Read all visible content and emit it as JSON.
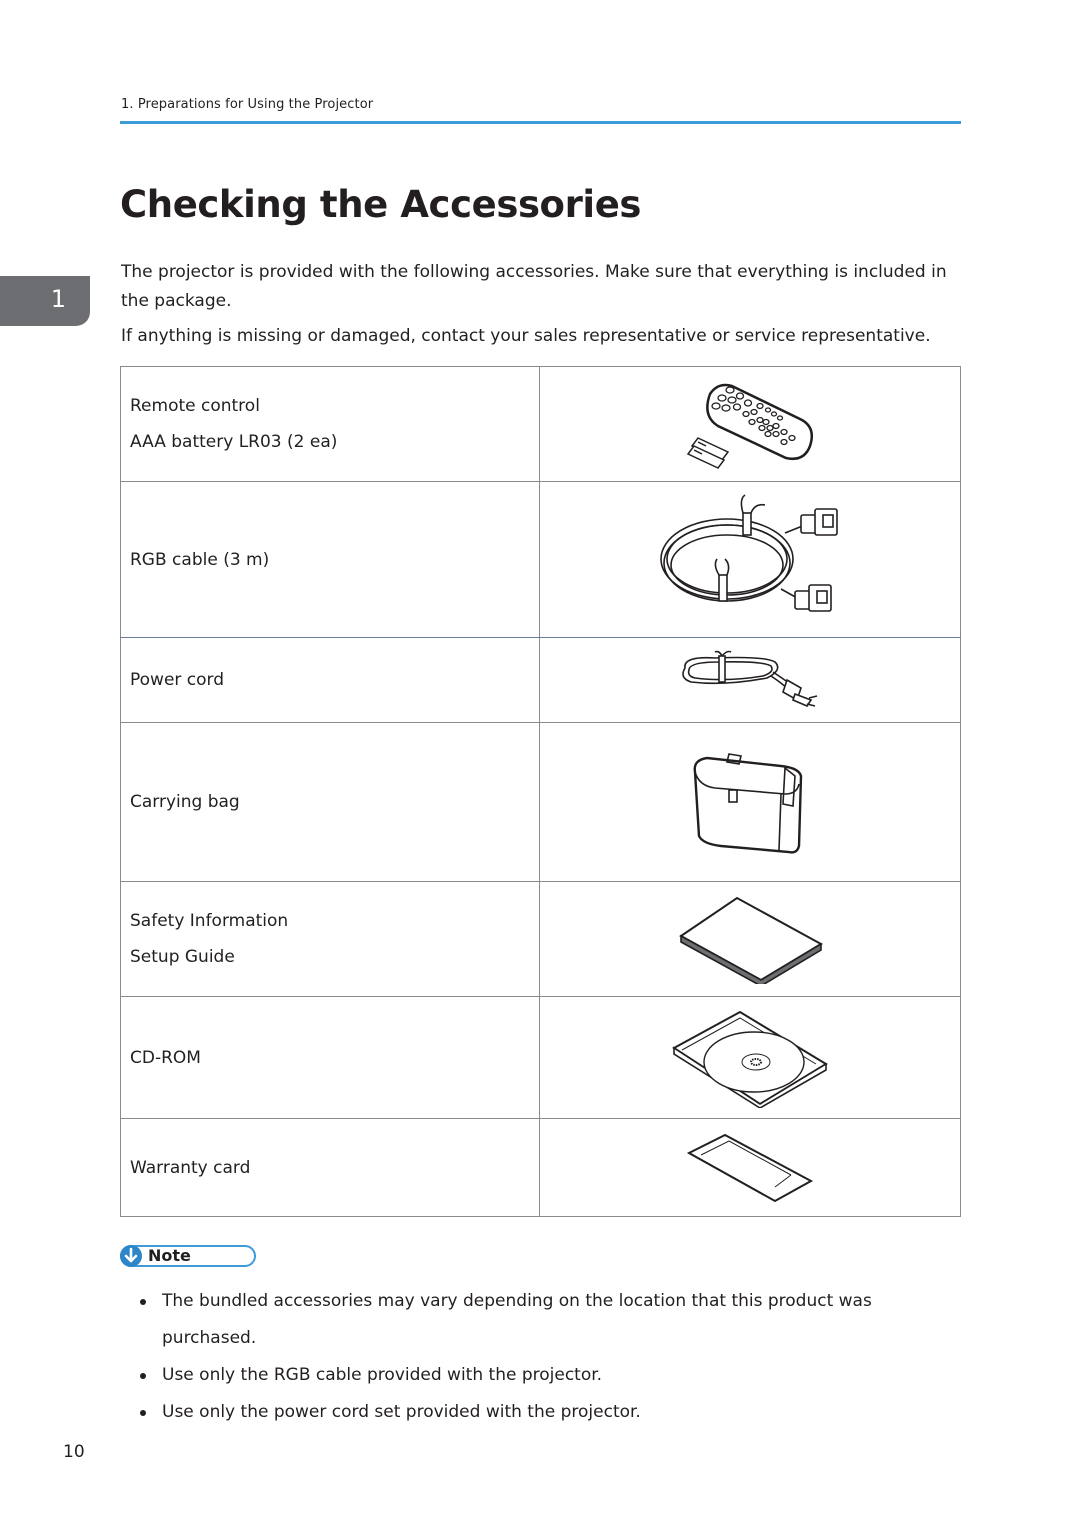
{
  "header": {
    "running_head": "1. Preparations for Using the Projector",
    "accent_color": "#3d9bd9"
  },
  "chapter_tab": {
    "number": "1"
  },
  "title": "Checking the Accessories",
  "intro": {
    "paragraph1": "The projector is provided with the following accessories. Make sure that everything is included in the package.",
    "paragraph2": "If anything is missing or damaged, contact your sales representative or service representative."
  },
  "accessories": [
    {
      "lines": [
        "Remote control",
        "AAA battery LR03 (2 ea)"
      ],
      "icon": "remote-control-icon"
    },
    {
      "lines": [
        "RGB cable (3 m)"
      ],
      "icon": "rgb-cable-icon"
    },
    {
      "lines": [
        "Power cord"
      ],
      "icon": "power-cord-icon"
    },
    {
      "lines": [
        "Carrying bag"
      ],
      "icon": "carrying-bag-icon"
    },
    {
      "lines": [
        "Safety Information",
        "Setup Guide"
      ],
      "icon": "manual-booklet-icon"
    },
    {
      "lines": [
        "CD-ROM"
      ],
      "icon": "cd-rom-icon"
    },
    {
      "lines": [
        "Warranty card"
      ],
      "icon": "warranty-card-icon"
    }
  ],
  "note": {
    "label": "Note",
    "icon": "down-arrow-icon",
    "items": [
      "The bundled accessories may vary depending on the location that this product was purchased.",
      "Use only the RGB cable provided with the projector.",
      "Use only the power cord set provided with the projector."
    ]
  },
  "footer": {
    "page_number": "10"
  }
}
